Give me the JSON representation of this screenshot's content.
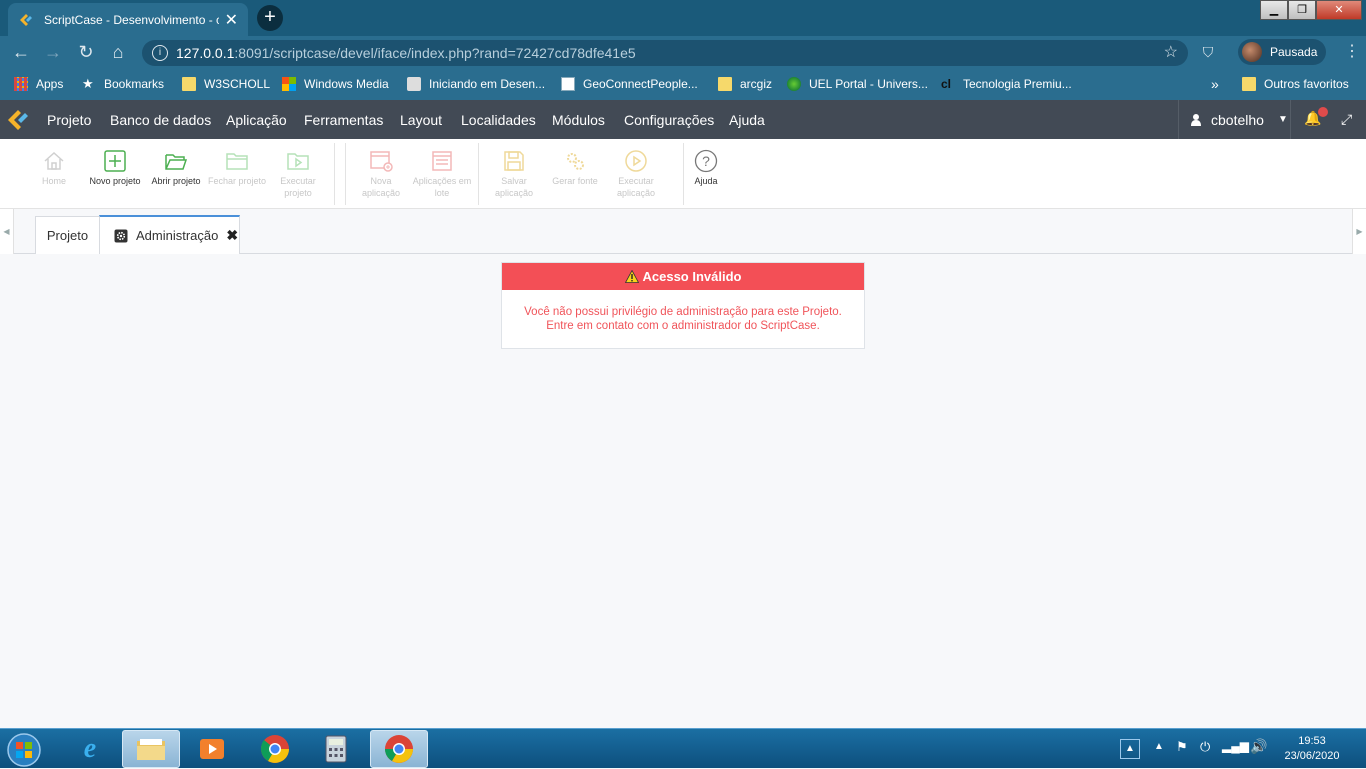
{
  "browser": {
    "tab_title": "ScriptCase - Desenvolvimento - c",
    "url_host": "127.0.0.1",
    "url_rest": ":8091/scriptcase/devel/iface/index.php?rand=72427cd78dfe41e5",
    "profile_label": "Pausada"
  },
  "bookmarks": {
    "items": [
      "Apps",
      "Bookmarks",
      "W3SCHOLL",
      "Windows Media",
      "Iniciando em Desen...",
      "GeoConnectPeople...",
      "arcgiz",
      "UEL Portal - Univers...",
      "Tecnologia Premiu..."
    ],
    "overflow": "»",
    "other": "Outros favoritos"
  },
  "menu": {
    "items": [
      "Projeto",
      "Banco de dados",
      "Aplicação",
      "Ferramentas",
      "Layout",
      "Localidades",
      "Módulos",
      "Configurações",
      "Ajuda"
    ],
    "user": "cbotelho"
  },
  "toolbar": {
    "home": "Home",
    "novo_projeto": "Novo projeto",
    "abrir_projeto": "Abrir projeto",
    "fechar_projeto": "Fechar projeto",
    "executar_projeto": "Executar projeto",
    "nova_aplicacao": "Nova aplicação",
    "aplicacoes_em_lote": "Aplicações em lote",
    "salvar_aplicacao": "Salvar aplicação",
    "gerar_fonte": "Gerar fonte",
    "executar_aplicacao": "Executar aplicação",
    "ajuda": "Ajuda"
  },
  "tabs": {
    "projeto": "Projeto",
    "administracao": "Administração"
  },
  "alert": {
    "title": "Acesso Inválido",
    "line1": "Você não possui privilégio de administração para este Projeto.",
    "line2": "Entre em contato com o administrador do ScriptCase."
  },
  "taskbar": {
    "time": "19:53",
    "date": "23/06/2020"
  },
  "colors": {
    "alert_header": "#f34f56",
    "menu_bg": "#424a55",
    "browser_bg": "#2a6d8f"
  }
}
